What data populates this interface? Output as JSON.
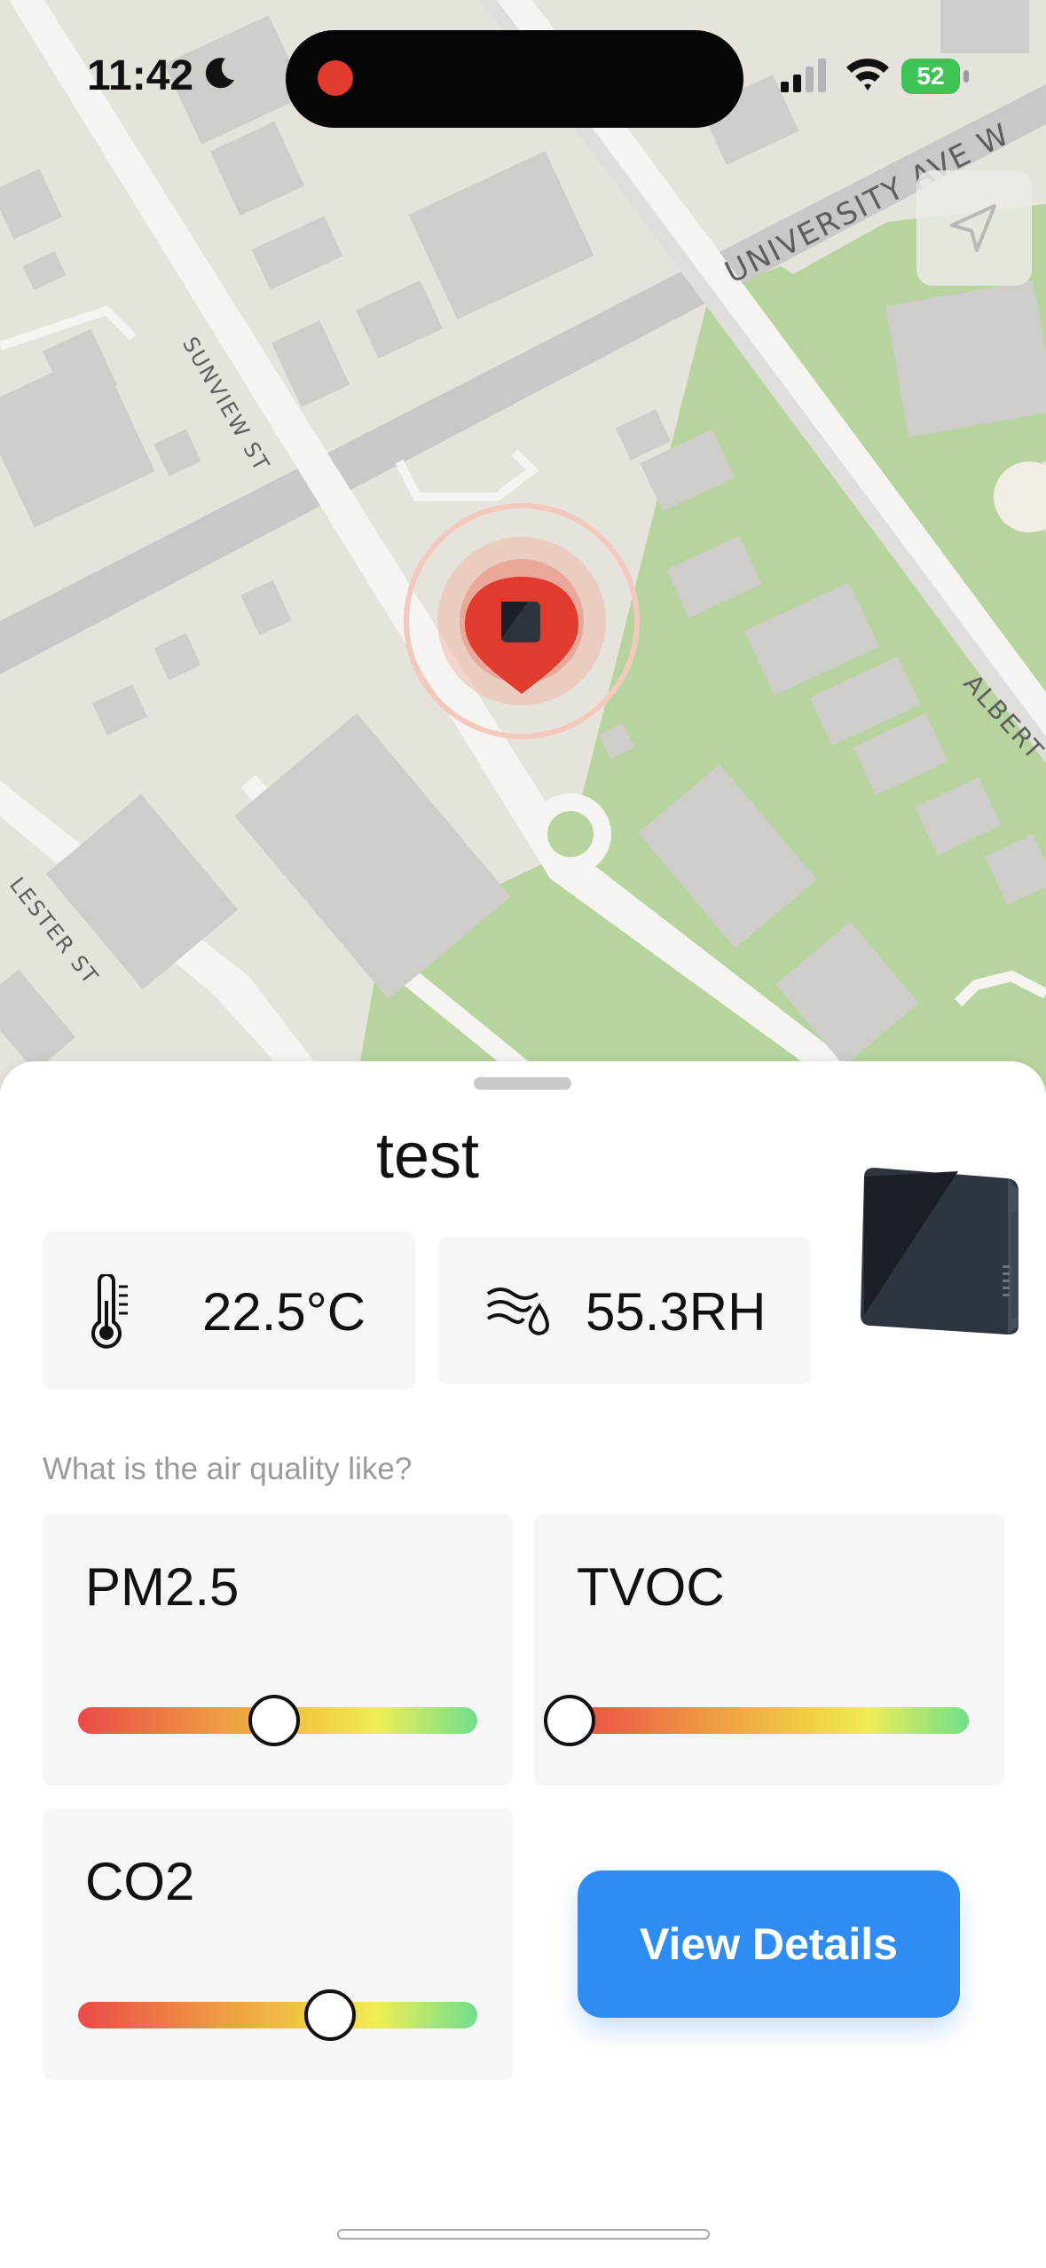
{
  "status_bar": {
    "time": "11:42",
    "battery": "52"
  },
  "map": {
    "streets": {
      "university": "UNIVERSITY AVE W",
      "sunview": "SUNVIEW ST",
      "lester": "LESTER ST",
      "albert": "ALBERT"
    }
  },
  "device": {
    "name": "test"
  },
  "metrics": {
    "temperature": "22.5°C",
    "humidity": "55.3RH"
  },
  "air_quality": {
    "prompt": "What is the air quality like?",
    "indicators": [
      {
        "label": "PM2.5",
        "level": 0.49
      },
      {
        "label": "TVOC",
        "level": 0.0
      },
      {
        "label": "CO2",
        "level": 0.63
      }
    ]
  },
  "actions": {
    "view_details": "View Details"
  },
  "colors": {
    "accent": "#2f8cf2",
    "pin": "#e13b2e",
    "card": "#f6f5f8"
  }
}
